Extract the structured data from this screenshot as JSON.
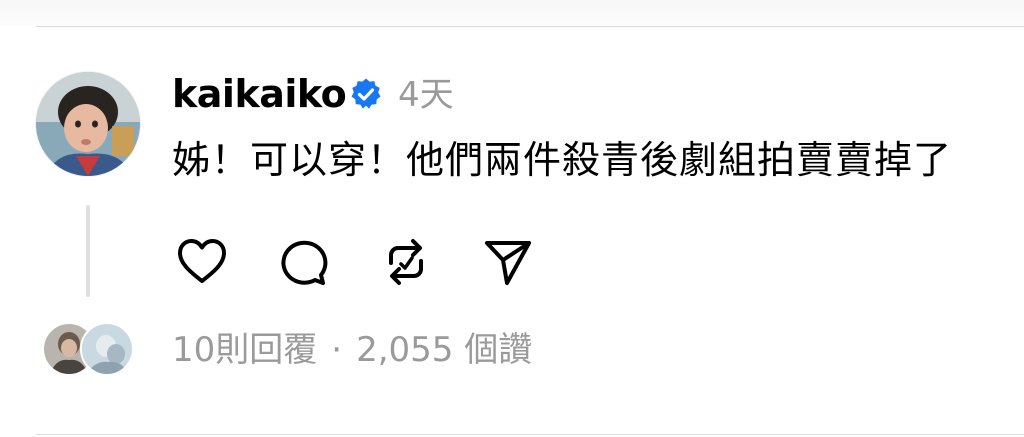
{
  "post": {
    "username": "kaikaiko",
    "timestamp": "4天",
    "text": "姊！可以穿！他們兩件殺青後劇組拍賣賣掉了",
    "replies_label": "10則回覆",
    "separator": "·",
    "likes_label": "2,055 個讚"
  },
  "icons": {
    "verified": "verified-badge-icon",
    "like": "heart-icon",
    "comment": "comment-icon",
    "repost": "repost-icon",
    "share": "send-icon"
  },
  "colors": {
    "verified": "#1877f2",
    "secondary_text": "#9a9a9a",
    "primary_text": "#000000"
  }
}
